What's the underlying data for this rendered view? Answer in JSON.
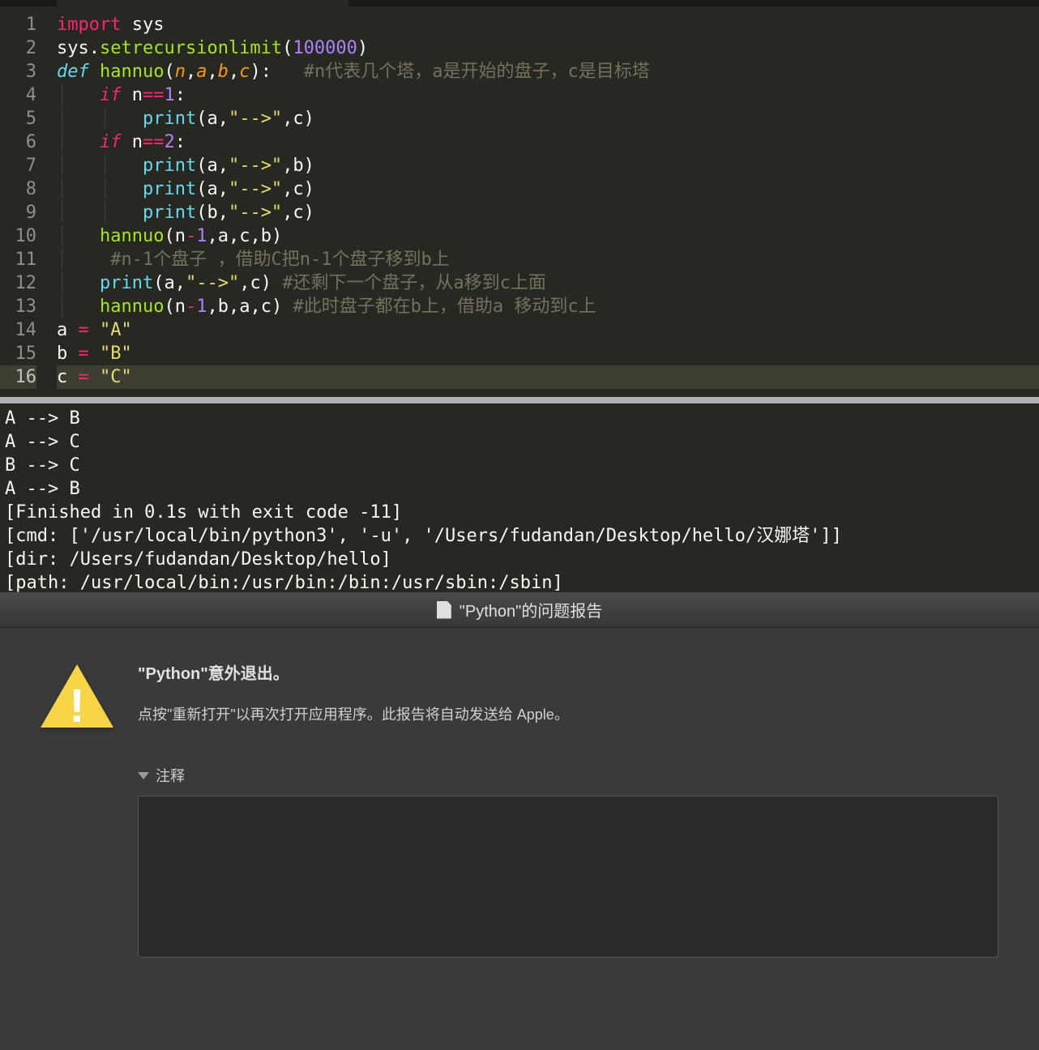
{
  "editor": {
    "lines": [
      {
        "num": "1",
        "tokens": [
          {
            "t": "import ",
            "c": "tok-import"
          },
          {
            "t": "sys",
            "c": "tok-module"
          }
        ]
      },
      {
        "num": "2",
        "tokens": [
          {
            "t": "sys",
            "c": "tok-var"
          },
          {
            "t": ".",
            "c": "tok-punct"
          },
          {
            "t": "setrecursionlimit",
            "c": "tok-funcname"
          },
          {
            "t": "(",
            "c": "tok-punct"
          },
          {
            "t": "100000",
            "c": "tok-number"
          },
          {
            "t": ")",
            "c": "tok-punct"
          }
        ]
      },
      {
        "num": "3",
        "tokens": [
          {
            "t": "def",
            "c": "tok-keyword-def"
          },
          {
            "t": " ",
            "c": ""
          },
          {
            "t": "hannuo",
            "c": "tok-funcname"
          },
          {
            "t": "(",
            "c": "tok-punct"
          },
          {
            "t": "n",
            "c": "tok-param"
          },
          {
            "t": ",",
            "c": "tok-punct"
          },
          {
            "t": "a",
            "c": "tok-param"
          },
          {
            "t": ",",
            "c": "tok-punct"
          },
          {
            "t": "b",
            "c": "tok-param"
          },
          {
            "t": ",",
            "c": "tok-punct"
          },
          {
            "t": "c",
            "c": "tok-param"
          },
          {
            "t": ")",
            "c": "tok-punct"
          },
          {
            "t": ":",
            "c": "tok-punct"
          },
          {
            "t": "   ",
            "c": ""
          },
          {
            "t": "#n代表几个塔，a是开始的盘子，c是目标塔",
            "c": "tok-comment"
          }
        ]
      },
      {
        "num": "4",
        "tokens": [
          {
            "t": "│   ",
            "c": "indent-guide"
          },
          {
            "t": "if",
            "c": "tok-keyword"
          },
          {
            "t": " n",
            "c": "tok-var"
          },
          {
            "t": "==",
            "c": "tok-operator"
          },
          {
            "t": "1",
            "c": "tok-number"
          },
          {
            "t": ":",
            "c": "tok-punct"
          }
        ]
      },
      {
        "num": "5",
        "tokens": [
          {
            "t": "│   │   ",
            "c": "indent-guide"
          },
          {
            "t": "print",
            "c": "tok-builtin"
          },
          {
            "t": "(a,",
            "c": "tok-punct"
          },
          {
            "t": "\"-->\"",
            "c": "tok-string"
          },
          {
            "t": ",c)",
            "c": "tok-punct"
          }
        ]
      },
      {
        "num": "6",
        "tokens": [
          {
            "t": "│   ",
            "c": "indent-guide"
          },
          {
            "t": "if",
            "c": "tok-keyword"
          },
          {
            "t": " n",
            "c": "tok-var"
          },
          {
            "t": "==",
            "c": "tok-operator"
          },
          {
            "t": "2",
            "c": "tok-number"
          },
          {
            "t": ":",
            "c": "tok-punct"
          }
        ]
      },
      {
        "num": "7",
        "tokens": [
          {
            "t": "│   │   ",
            "c": "indent-guide"
          },
          {
            "t": "print",
            "c": "tok-builtin"
          },
          {
            "t": "(a,",
            "c": "tok-punct"
          },
          {
            "t": "\"-->\"",
            "c": "tok-string"
          },
          {
            "t": ",b)",
            "c": "tok-punct"
          }
        ]
      },
      {
        "num": "8",
        "tokens": [
          {
            "t": "│   │   ",
            "c": "indent-guide"
          },
          {
            "t": "print",
            "c": "tok-builtin"
          },
          {
            "t": "(a,",
            "c": "tok-punct"
          },
          {
            "t": "\"-->\"",
            "c": "tok-string"
          },
          {
            "t": ",c)",
            "c": "tok-punct"
          }
        ]
      },
      {
        "num": "9",
        "tokens": [
          {
            "t": "│   │   ",
            "c": "indent-guide"
          },
          {
            "t": "print",
            "c": "tok-builtin"
          },
          {
            "t": "(b,",
            "c": "tok-punct"
          },
          {
            "t": "\"-->\"",
            "c": "tok-string"
          },
          {
            "t": ",c)",
            "c": "tok-punct"
          }
        ]
      },
      {
        "num": "10",
        "tokens": [
          {
            "t": "│   ",
            "c": "indent-guide"
          },
          {
            "t": "hannuo",
            "c": "tok-funcname"
          },
          {
            "t": "(n",
            "c": "tok-punct"
          },
          {
            "t": "-",
            "c": "tok-operator"
          },
          {
            "t": "1",
            "c": "tok-number"
          },
          {
            "t": ",a,c,b)",
            "c": "tok-punct"
          }
        ]
      },
      {
        "num": "11",
        "tokens": [
          {
            "t": "│   ",
            "c": "indent-guide"
          },
          {
            "t": " ",
            "c": ""
          },
          {
            "t": "#n-1个盘子 ，借助C把n-1个盘子移到b上",
            "c": "tok-comment"
          }
        ]
      },
      {
        "num": "12",
        "tokens": [
          {
            "t": "│   ",
            "c": "indent-guide"
          },
          {
            "t": "print",
            "c": "tok-builtin"
          },
          {
            "t": "(a,",
            "c": "tok-punct"
          },
          {
            "t": "\"-->\"",
            "c": "tok-string"
          },
          {
            "t": ",c) ",
            "c": "tok-punct"
          },
          {
            "t": "#还剩下一个盘子，从a移到c上面",
            "c": "tok-comment"
          }
        ]
      },
      {
        "num": "13",
        "tokens": [
          {
            "t": "│   ",
            "c": "indent-guide"
          },
          {
            "t": "hannuo",
            "c": "tok-funcname"
          },
          {
            "t": "(n",
            "c": "tok-punct"
          },
          {
            "t": "-",
            "c": "tok-operator"
          },
          {
            "t": "1",
            "c": "tok-number"
          },
          {
            "t": ",b,a,c) ",
            "c": "tok-punct"
          },
          {
            "t": "#此时盘子都在b上，借助a 移动到c上",
            "c": "tok-comment"
          }
        ]
      },
      {
        "num": "14",
        "tokens": [
          {
            "t": "a ",
            "c": "tok-var"
          },
          {
            "t": "=",
            "c": "tok-operator"
          },
          {
            "t": " ",
            "c": ""
          },
          {
            "t": "\"A\"",
            "c": "tok-string"
          }
        ]
      },
      {
        "num": "15",
        "tokens": [
          {
            "t": "b ",
            "c": "tok-var"
          },
          {
            "t": "=",
            "c": "tok-operator"
          },
          {
            "t": " ",
            "c": ""
          },
          {
            "t": "\"B\"",
            "c": "tok-string"
          }
        ]
      },
      {
        "num": "16",
        "current": true,
        "tokens": [
          {
            "t": "c ",
            "c": "tok-var"
          },
          {
            "t": "=",
            "c": "tok-operator"
          },
          {
            "t": " ",
            "c": ""
          },
          {
            "t": "\"C\"",
            "c": "tok-string"
          }
        ]
      }
    ]
  },
  "output": {
    "lines": [
      "A --> B",
      "A --> C",
      "B --> C",
      "A --> B",
      "[Finished in 0.1s with exit code -11]",
      "[cmd: ['/usr/local/bin/python3', '-u', '/Users/fudandan/Desktop/hello/汉娜塔']]",
      "[dir: /Users/fudandan/Desktop/hello]",
      "[path: /usr/local/bin:/usr/bin:/bin:/usr/sbin:/sbin]"
    ]
  },
  "crash": {
    "title": "\"Python\"的问题报告",
    "heading": "\"Python\"意外退出。",
    "message": "点按\"重新打开\"以再次打开应用程序。此报告将自动发送给 Apple。",
    "notes_label": "注释"
  }
}
